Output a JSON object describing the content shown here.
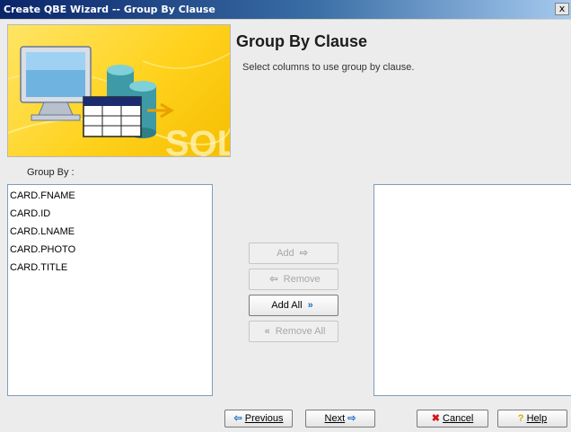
{
  "window": {
    "title": "Create QBE Wizard -- Group By Clause",
    "close_symbol": "x"
  },
  "banner": {
    "watermark": "SQL",
    "icon": "database-monitor-table-illustration"
  },
  "header": {
    "title": "Group By Clause",
    "description": "Select columns to use group by clause."
  },
  "group_by": {
    "label": "Group By :",
    "available_columns": [
      "CARD.FNAME",
      "CARD.ID",
      "CARD.LNAME",
      "CARD.PHOTO",
      "CARD.TITLE"
    ],
    "selected_columns": []
  },
  "transfer_buttons": {
    "add": {
      "label": "Add",
      "enabled": false
    },
    "remove": {
      "label": "Remove",
      "enabled": false
    },
    "add_all": {
      "label": "Add All",
      "enabled": true
    },
    "remove_all": {
      "label": "Remove All",
      "enabled": false
    }
  },
  "nav_buttons": {
    "previous": "Previous",
    "next": "Next",
    "cancel": "Cancel",
    "help": "Help"
  },
  "colors": {
    "title_gradient_start": "#0a246a",
    "banner_yellow": "#ffd21e",
    "accent_blue": "#1f6fc2",
    "cancel_red": "#d01818"
  }
}
